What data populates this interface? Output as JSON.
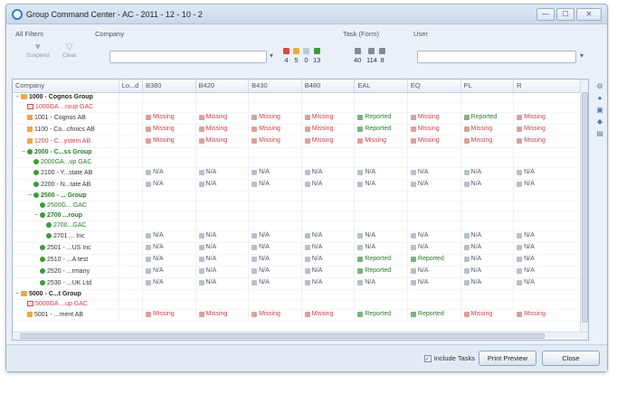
{
  "window": {
    "title": "Group Command Center - AC - 2011 - 12 - 10 - 2",
    "buttons": [
      "—",
      "☐",
      "✕"
    ]
  },
  "filters": {
    "all_filters": "All Filters",
    "company": "Company",
    "task_form": "Task (Form)",
    "user": "User",
    "suspend": "Suspend",
    "clear": "Clear",
    "company_value": "",
    "user_value": ""
  },
  "stats_left": [
    {
      "count": "4",
      "color": "#d94b3f"
    },
    {
      "count": "5",
      "color": "#e9a94a"
    },
    {
      "count": "0",
      "color": "#bfc7d1"
    },
    {
      "count": "13",
      "color": "#3c9a3c"
    }
  ],
  "stats_right": [
    {
      "count": "40",
      "color": "#7f8a96"
    },
    {
      "count": "114",
      "color": "#7f8a96"
    },
    {
      "count": "8",
      "color": "#7f8a96"
    }
  ],
  "columns": [
    "Company",
    "Lo...d",
    "B380",
    "B420",
    "B430",
    "B480",
    "EAL",
    "EQ",
    "PL",
    "R"
  ],
  "status_labels": {
    "missing": "Missing",
    "reported": "Reported",
    "na": "N/A"
  },
  "rows": [
    {
      "name": "1000 - Cognos Group",
      "style": "group",
      "icon": "folder",
      "indent": 0,
      "toggle": "−",
      "cells": []
    },
    {
      "name": "1000GA ...roup GAC",
      "style": "red",
      "icon": "redbox",
      "indent": 1,
      "toggle": "",
      "cells": []
    },
    {
      "name": "1001 - Cognos AB",
      "style": "plain",
      "icon": "doc",
      "indent": 1,
      "toggle": "",
      "cells": [
        "missing",
        "missing",
        "missing",
        "missing",
        "reported",
        "missing",
        "reported",
        "missing"
      ]
    },
    {
      "name": "1100 - Co...chnics AB",
      "style": "plain",
      "icon": "doc",
      "indent": 1,
      "toggle": "",
      "cells": [
        "missing",
        "missing",
        "missing",
        "missing",
        "reported",
        "missing",
        "missing",
        "missing"
      ]
    },
    {
      "name": "1200 - C...ystem AB",
      "style": "red",
      "icon": "doc",
      "indent": 1,
      "toggle": "",
      "cells": [
        "missing",
        "missing",
        "missing",
        "missing",
        "missing",
        "missing",
        "missing",
        "missing"
      ]
    },
    {
      "name": "2000 - C...ss Group",
      "style": "group-green",
      "icon": "dot",
      "indent": 1,
      "toggle": "−",
      "cells": []
    },
    {
      "name": "2000GA...up GAC",
      "style": "gac",
      "icon": "dot",
      "indent": 2,
      "toggle": "",
      "cells": []
    },
    {
      "name": "2100 - Y...state AB",
      "style": "plain",
      "icon": "dot",
      "indent": 2,
      "toggle": "",
      "cells": [
        "na",
        "na",
        "na",
        "na",
        "na",
        "na",
        "na",
        "na"
      ]
    },
    {
      "name": "2200 - N...tate AB",
      "style": "plain",
      "icon": "dot",
      "indent": 2,
      "toggle": "",
      "cells": [
        "na",
        "na",
        "na",
        "na",
        "na",
        "na",
        "na",
        "na"
      ]
    },
    {
      "name": "2500 - ... Group",
      "style": "group-green",
      "icon": "dot",
      "indent": 2,
      "toggle": "−",
      "cells": []
    },
    {
      "name": "2500G... GAC",
      "style": "gac",
      "icon": "dot",
      "indent": 3,
      "toggle": "",
      "cells": []
    },
    {
      "name": "2700 ...roup",
      "style": "group-green",
      "icon": "dot",
      "indent": 3,
      "toggle": "−",
      "cells": []
    },
    {
      "name": "2700...GAC",
      "style": "gac",
      "icon": "dot",
      "indent": 4,
      "toggle": "",
      "cells": []
    },
    {
      "name": "2701 ... Inc",
      "style": "plain",
      "icon": "dot",
      "indent": 4,
      "toggle": "",
      "cells": [
        "na",
        "na",
        "na",
        "na",
        "na",
        "na",
        "na",
        "na"
      ]
    },
    {
      "name": "2501 - ...US Inc",
      "style": "plain",
      "icon": "dot",
      "indent": 3,
      "toggle": "",
      "cells": [
        "na",
        "na",
        "na",
        "na",
        "na",
        "na",
        "na",
        "na"
      ]
    },
    {
      "name": "2510 - ...A test",
      "style": "plain",
      "icon": "dot",
      "indent": 3,
      "toggle": "",
      "cells": [
        "na",
        "na",
        "na",
        "na",
        "reported",
        "reported",
        "na",
        "na"
      ]
    },
    {
      "name": "2520 - ...rmany",
      "style": "plain",
      "icon": "dot",
      "indent": 3,
      "toggle": "",
      "cells": [
        "na",
        "na",
        "na",
        "na",
        "reported",
        "na",
        "na",
        "na"
      ]
    },
    {
      "name": "2530 - ...UK Ltd",
      "style": "plain",
      "icon": "dot",
      "indent": 3,
      "toggle": "",
      "cells": [
        "na",
        "na",
        "na",
        "na",
        "na",
        "na",
        "na",
        "na"
      ]
    },
    {
      "name": "5000 - C...t Group",
      "style": "group",
      "icon": "folder",
      "indent": 0,
      "toggle": "−",
      "cells": []
    },
    {
      "name": "5000GA ...up GAC",
      "style": "red",
      "icon": "redbox",
      "indent": 1,
      "toggle": "",
      "cells": []
    },
    {
      "name": "5001 - ...ment AB",
      "style": "plain",
      "icon": "doc",
      "indent": 1,
      "toggle": "",
      "cells": [
        "missing",
        "missing",
        "missing",
        "missing",
        "reported",
        "reported",
        "missing",
        "missing"
      ]
    }
  ],
  "footer": {
    "include_tasks": "Include Tasks",
    "include_tasks_checked": true,
    "print_preview": "Print Preview",
    "close": "Close"
  }
}
